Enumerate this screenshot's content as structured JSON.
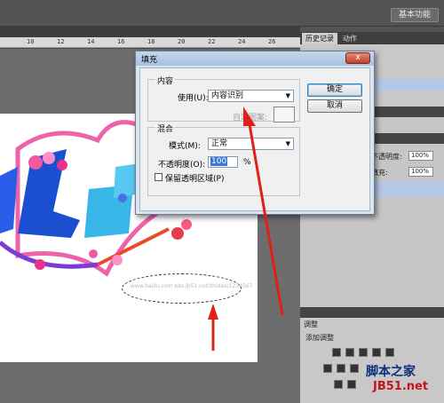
{
  "app": {
    "workspace_button": "基本功能"
  },
  "ruler": {
    "ticks": [
      "10",
      "12",
      "14",
      "16",
      "18",
      "20",
      "22",
      "24",
      "26"
    ]
  },
  "panels": {
    "history_tab": "历史记录",
    "actions_tab": "动作",
    "layers": {
      "opacity_label": "不透明度:",
      "opacity_value": "100%",
      "fill_label": "填充:",
      "fill_value": "100%"
    },
    "adjustments": {
      "title": "调整",
      "add_label": "添加调整"
    }
  },
  "canvas": {
    "watermark_text": "www.baidu.com  bbs.jb51.net/zhidao/1234567"
  },
  "dialog": {
    "title": "填充",
    "close_glyph": "x",
    "contents_group": "内容",
    "use_label": "使用(U):",
    "use_value": "内容识别",
    "custom_pattern_label": "自定图案:",
    "blending_group": "混合",
    "mode_label": "模式(M):",
    "mode_value": "正常",
    "opacity_label": "不透明度(O):",
    "opacity_value": "100",
    "opacity_unit": "%",
    "preserve_label": "保留透明区域(P)",
    "preserve_checked": false,
    "ok_button": "确定",
    "cancel_button": "取消"
  },
  "site_watermark": {
    "line1": "脚本之家",
    "line2": "JB51.net"
  },
  "colors": {
    "arrow": "#e0201a",
    "dialog_title": "#a9c0de",
    "selection_row": "#b4c8e6"
  }
}
